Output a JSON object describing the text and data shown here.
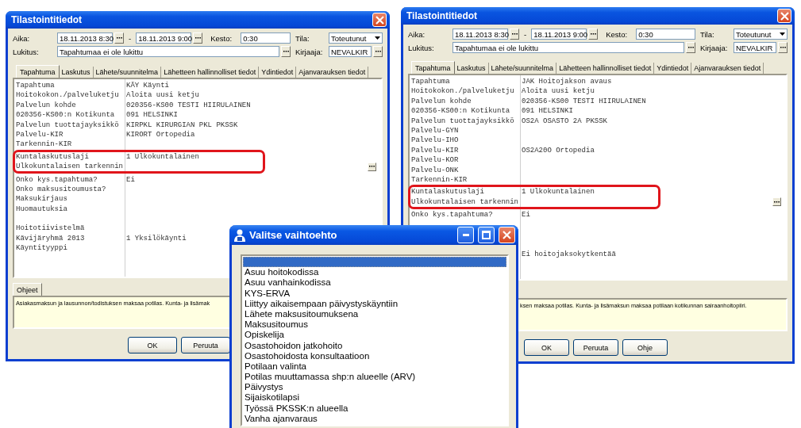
{
  "dialogs": [
    {
      "title": "Tilastointitiedot",
      "time_label": "Aika:",
      "start": "18.11.2013 8:30",
      "separator": "-",
      "end": "18.11.2013 9:00",
      "duration_label": "Kesto:",
      "duration": "0:30",
      "status_label": "Tila:",
      "status": "Toteutunut",
      "lock_label": "Lukitus:",
      "lock": "Tapahtumaa ei ole lukittu",
      "recorder_label": "Kirjaaja:",
      "recorder": "NEVALKIR",
      "tabs": [
        {
          "label": "Tapahtuma",
          "selected": true
        },
        {
          "label": "Laskutus",
          "selected": false
        },
        {
          "label": "Lähete/suunnitelma",
          "selected": false
        },
        {
          "label": "Lähetteen hallinnolliset tiedot",
          "selected": false
        },
        {
          "label": "Ydintiedot",
          "selected": false
        },
        {
          "label": "Ajanvarauksen tiedot",
          "selected": false
        }
      ],
      "rows": [
        {
          "kind": "text",
          "label": "Tapahtuma",
          "value": "KÄY Käynti",
          "outlined": false
        },
        {
          "kind": "text",
          "label": "Hoitokokon./palveluketju",
          "value": "Aloita uusi ketju",
          "outlined": false
        },
        {
          "kind": "text",
          "label": "Palvelun kohde",
          "value": "020356-KS00 TESTI HIIRULAINEN",
          "outlined": false
        },
        {
          "kind": "text",
          "label": "020356-KS00:n Kotikunta",
          "value": "091 HELSINKI",
          "outlined": false
        },
        {
          "kind": "text",
          "label": "Palvelun tuottajayksikkö",
          "value": "KIRPKL KIRURGIAN PKL PKSSK",
          "outlined": false
        },
        {
          "kind": "text",
          "label": "Palvelu-KIR",
          "value": "KIRORT Ortopedia",
          "outlined": false
        },
        {
          "kind": "text",
          "label": "Tarkennin-KIR",
          "outlined": false
        },
        {
          "kind": "text",
          "label": "Kuntalaskutuslaji",
          "value": "1 Ulkokuntalainen",
          "outlined": true
        },
        {
          "kind": "picker",
          "label": "Ulkokuntalaisen tarkennin",
          "outlined": true
        },
        {
          "kind": "text",
          "label": "Onko kys.tapahtuma?",
          "value": "Ei",
          "outlined": false
        },
        {
          "kind": "text",
          "label": "Onko maksusitoumusta?",
          "outlined": false
        },
        {
          "kind": "text",
          "label": "Maksukirjaus",
          "outlined": false
        },
        {
          "kind": "text",
          "label": "Huomautuksia",
          "outlined": false
        },
        {
          "kind": "blank",
          "outlined": false
        },
        {
          "kind": "text",
          "label": "Hoitotiivistelmä",
          "outlined": false
        },
        {
          "kind": "text",
          "label": "Kävijäryhmä 2013",
          "value": "1 Yksilökäynti",
          "outlined": false
        },
        {
          "kind": "text",
          "label": "Käyntityyppi",
          "outlined": false
        }
      ],
      "help_tab": "Ohjeet",
      "help_text": "Asiakasmaksun ja lausunnon/todistuksen maksaa potilas. Kunta- ja lisämak",
      "buttons": [
        "OK",
        "Peruuta"
      ]
    },
    {
      "title": "Tilastointitiedot",
      "time_label": "Aika:",
      "start": "18.11.2013 8:30",
      "separator": "-",
      "end": "18.11.2013 9:00",
      "duration_label": "Kesto:",
      "duration": "0:30",
      "status_label": "Tila:",
      "status": "Toteutunut",
      "lock_label": "Lukitus:",
      "lock": "Tapahtumaa ei ole lukittu",
      "recorder_label": "Kirjaaja:",
      "recorder": "NEVALKIR",
      "tabs": [
        {
          "label": "Tapahtuma",
          "selected": true
        },
        {
          "label": "Laskutus",
          "selected": false
        },
        {
          "label": "Lähete/suunnitelma",
          "selected": false
        },
        {
          "label": "Lähetteen hallinnolliset tiedot",
          "selected": false
        },
        {
          "label": "Ydintiedot",
          "selected": false
        },
        {
          "label": "Ajanvarauksen tiedot",
          "selected": false
        }
      ],
      "rows": [
        {
          "kind": "text",
          "label": "Tapahtuma",
          "value": "JAK Hoitojakson avaus",
          "outlined": false
        },
        {
          "kind": "text",
          "label": "Hoitokokon./palveluketju",
          "value": "Aloita uusi ketju",
          "outlined": false
        },
        {
          "kind": "text",
          "label": "Palvelun kohde",
          "value": "020356-KS00 TESTI HIIRULAINEN",
          "outlined": false
        },
        {
          "kind": "text",
          "label": "020356-KS00:n Kotikunta",
          "value": "091 HELSINKI",
          "outlined": false
        },
        {
          "kind": "text",
          "label": "Palvelun tuottajayksikkö",
          "value": "OS2A OSASTO 2A PKSSK",
          "outlined": false
        },
        {
          "kind": "text",
          "label": "Palvelu-GYN",
          "outlined": false
        },
        {
          "kind": "text",
          "label": "Palvelu-IHO",
          "outlined": false
        },
        {
          "kind": "text",
          "label": "Palvelu-KIR",
          "value": "OS2A20O Ortopedia",
          "outlined": false
        },
        {
          "kind": "text",
          "label": "Palvelu-KOR",
          "outlined": false
        },
        {
          "kind": "text",
          "label": "Palvelu-ONK",
          "outlined": false
        },
        {
          "kind": "text",
          "label": "Tarkennin-KIR",
          "outlined": false
        },
        {
          "kind": "text",
          "label": "Kuntalaskutuslaji",
          "value": "1 Ulkokuntalainen",
          "outlined": true
        },
        {
          "kind": "picker",
          "label": "Ulkokuntalaisen tarkennin",
          "outlined": true
        },
        {
          "kind": "text",
          "label": "Onko kys.tapahtuma?",
          "value": "Ei",
          "outlined": false
        },
        {
          "kind": "blank",
          "outlined": false
        },
        {
          "kind": "blank",
          "outlined": false
        },
        {
          "kind": "blank",
          "outlined": false
        },
        {
          "kind": "text",
          "value": "Ei hoitojaksokytkentää",
          "outlined": false
        }
      ],
      "help_text": "ksen maksaa potilas. Kunta- ja lisämaksun maksaa potilaan kotikunnan sairaanhoitopiiri.",
      "buttons": [
        "OK",
        "Peruuta",
        "Ohje"
      ]
    }
  ],
  "chooser": {
    "title": "Valitse vaihtoehto",
    "options": [
      {
        "selected": true
      },
      {
        "label": "Asuu hoitokodissa",
        "selected": false
      },
      {
        "label": "Asuu vanhainkodissa",
        "selected": false
      },
      {
        "label": "KYS-ERVA",
        "selected": false
      },
      {
        "label": "Liittyy aikaisempaan päivystyskäyntiin",
        "selected": false
      },
      {
        "label": "Lähete maksusitoumuksena",
        "selected": false
      },
      {
        "label": "Maksusitoumus",
        "selected": false
      },
      {
        "label": "Opiskelija",
        "selected": false
      },
      {
        "label": "Osastohoidon jatkohoito",
        "selected": false
      },
      {
        "label": "Osastohoidosta konsultaatioon",
        "selected": false
      },
      {
        "label": "Potilaan valinta",
        "selected": false
      },
      {
        "label": "Potilas muuttamassa shp:n alueelle (ARV)",
        "selected": false
      },
      {
        "label": "Päivystys",
        "selected": false
      },
      {
        "label": "Sijaiskotilapsi",
        "selected": false
      },
      {
        "label": "Työssä PKSSK:n alueella",
        "selected": false
      },
      {
        "label": "Vanha ajanvaraus",
        "selected": false
      }
    ]
  }
}
